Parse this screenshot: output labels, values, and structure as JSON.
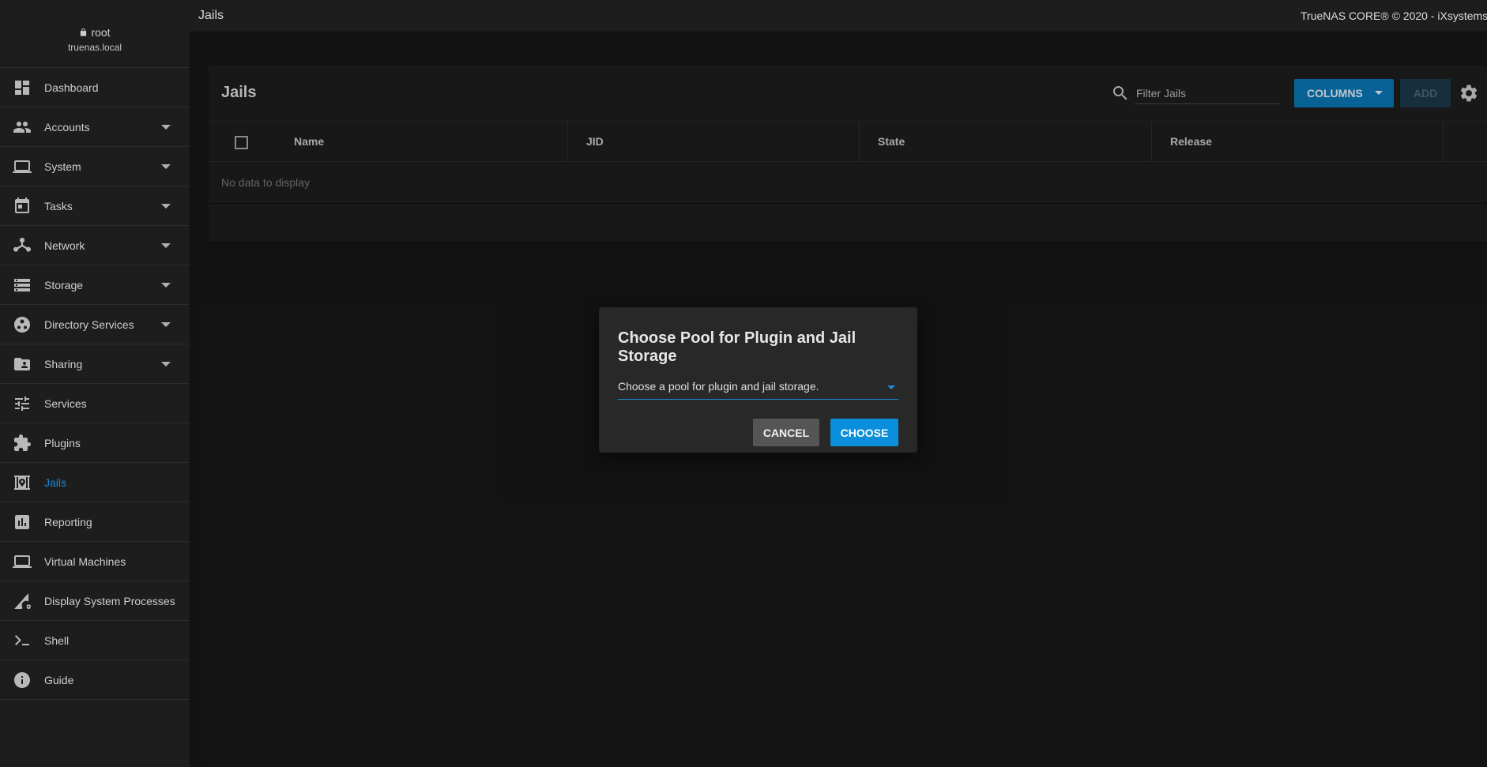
{
  "user": {
    "name": "root",
    "host": "truenas.local"
  },
  "topbar": {
    "title": "Jails",
    "copyright": "TrueNAS CORE® © 2020 - iXsystems"
  },
  "sidebar": {
    "items": [
      {
        "label": "Dashboard",
        "icon": "dashboard-icon",
        "expandable": false
      },
      {
        "label": "Accounts",
        "icon": "people-icon",
        "expandable": true
      },
      {
        "label": "System",
        "icon": "laptop-icon",
        "expandable": true
      },
      {
        "label": "Tasks",
        "icon": "calendar-icon",
        "expandable": true
      },
      {
        "label": "Network",
        "icon": "network-icon",
        "expandable": true
      },
      {
        "label": "Storage",
        "icon": "storage-icon",
        "expandable": true
      },
      {
        "label": "Directory Services",
        "icon": "directory-icon",
        "expandable": true
      },
      {
        "label": "Sharing",
        "icon": "folder-shared-icon",
        "expandable": true
      },
      {
        "label": "Services",
        "icon": "tune-icon",
        "expandable": false
      },
      {
        "label": "Plugins",
        "icon": "puzzle-icon",
        "expandable": false
      },
      {
        "label": "Jails",
        "icon": "jail-icon",
        "expandable": false,
        "active": true
      },
      {
        "label": "Reporting",
        "icon": "chart-icon",
        "expandable": false
      },
      {
        "label": "Virtual Machines",
        "icon": "laptop-icon",
        "expandable": false
      },
      {
        "label": "Display System Processes",
        "icon": "processes-icon",
        "expandable": false
      },
      {
        "label": "Shell",
        "icon": "terminal-icon",
        "expandable": false
      },
      {
        "label": "Guide",
        "icon": "info-icon",
        "expandable": false
      }
    ]
  },
  "card": {
    "title": "Jails",
    "filter_placeholder": "Filter Jails",
    "columns_label": "COLUMNS",
    "add_label": "ADD",
    "table": {
      "columns": [
        "Name",
        "JID",
        "State",
        "Release"
      ],
      "empty_text": "No data to display"
    }
  },
  "dialog": {
    "title": "Choose Pool for Plugin and Jail Storage",
    "select_label": "Choose a pool for plugin and jail storage.",
    "cancel_label": "CANCEL",
    "choose_label": "CHOOSE"
  },
  "colors": {
    "accent": "#0a8fdc",
    "active_nav": "#1a8bd6"
  }
}
